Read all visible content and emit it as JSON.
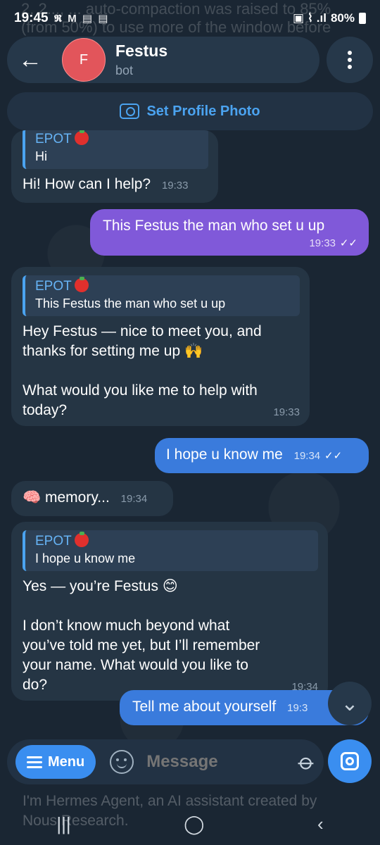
{
  "status_bar": {
    "time": "19:45",
    "notif_icons": "𝕽 M ▤ ▤",
    "right_icons": "▣ ⌇ .ıl",
    "battery": "80%"
  },
  "ghost_top": "2. 2..., ... auto-compaction was raised to 85% (from 50%) to use more of the window before summarizing ... the ... impr...",
  "header": {
    "avatar_letter": "F",
    "title": "Festus",
    "subtitle": "bot"
  },
  "profile_photo_label": "Set Profile Photo",
  "messages": [
    {
      "quote_author": "EPOT",
      "quote_text": "Hi",
      "text": "Hi! How can I help?",
      "time": "19:33"
    },
    {
      "text": "This Festus the man who set u up",
      "time": "19:33",
      "check": "✓✓"
    },
    {
      "quote_author": "EPOT",
      "quote_text": "This Festus the man who set u up",
      "text1": "Hey Festus — nice to meet you, and thanks for setting me up 🙌",
      "text2": "What would you like me to help with today?",
      "time": "19:33"
    },
    {
      "text": "I hope u know me",
      "time": "19:34",
      "check": "✓✓"
    },
    {
      "emoji": "🧠",
      "text": "memory...",
      "time": "19:34"
    },
    {
      "quote_author": "EPOT",
      "quote_text": "I hope u know me",
      "text1": "Yes — you’re Festus 😊",
      "text2": "I don’t know much beyond what you’ve told me yet, but I’ll remember your name. What would you like to do?",
      "time": "19:34"
    },
    {
      "text": "Tell me about yourself",
      "time": "19:3"
    }
  ],
  "input": {
    "menu_label": "Menu",
    "placeholder": "Message"
  },
  "ghost_bottom": "I'm Hermes Agent, an AI assistant created by Nous Research.",
  "nav": {
    "recents": "|||",
    "home": "◯",
    "back": "‹"
  }
}
